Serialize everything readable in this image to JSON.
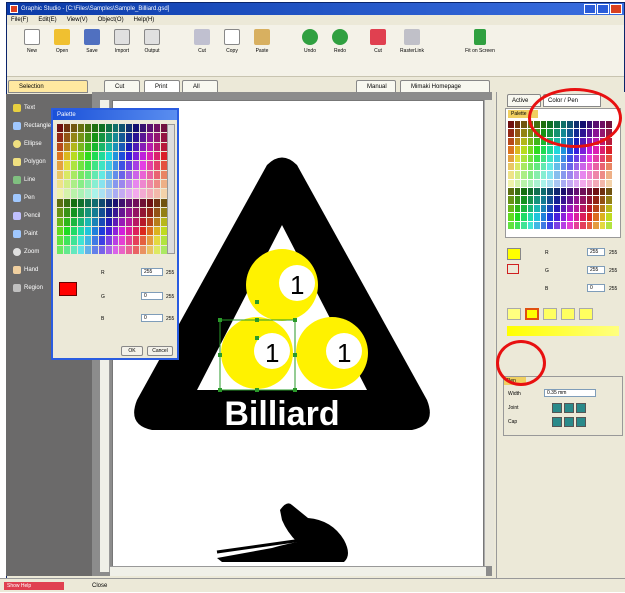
{
  "window": {
    "title": "Graphic Studio - [C:\\Files\\Samples\\Sample_Billiard.gsd]"
  },
  "menu": [
    "File(F)",
    "Edit(E)",
    "View(V)",
    "Object(O)",
    "Help(H)"
  ],
  "toolbar": [
    {
      "label": "New",
      "icon": "new-file-icon"
    },
    {
      "label": "Open",
      "icon": "folder-open-icon"
    },
    {
      "label": "Save",
      "icon": "save-icon"
    },
    {
      "label": "Import",
      "icon": "import-icon"
    },
    {
      "label": "Output",
      "icon": "output-icon"
    },
    {
      "label": "Cut",
      "icon": "scissors-icon"
    },
    {
      "label": "Copy",
      "icon": "copy-icon"
    },
    {
      "label": "Paste",
      "icon": "paste-icon"
    },
    {
      "label": "Undo",
      "icon": "undo-icon"
    },
    {
      "label": "Redo",
      "icon": "redo-icon"
    },
    {
      "label": "Cut",
      "icon": "cut-icon"
    },
    {
      "label": "RasterLink",
      "icon": "rasterlink-icon"
    },
    {
      "label": "Fit on Screen",
      "icon": "fit-screen-icon"
    }
  ],
  "tabs": {
    "selection": "Selection",
    "cut": "Cut",
    "print": "Print",
    "all": "All",
    "manual": "Manual",
    "homepage": "Mimaki Homepage"
  },
  "tools": [
    "Text",
    "Rectangle",
    "Ellipse",
    "Polygon",
    "Line",
    "Pen",
    "Pencil",
    "Paint",
    "Zoom",
    "Hand",
    "Region"
  ],
  "palette": {
    "title": "Palette",
    "values": [
      "255",
      "0",
      "0"
    ],
    "max": [
      "255",
      "255",
      "255"
    ],
    "ok": "OK",
    "cancel": "Cancel"
  },
  "canvas": {
    "text": "Billiard",
    "ball_number": "1"
  },
  "right_panel": {
    "tabs": [
      "Active",
      "Color / Pen"
    ],
    "palette_label": "Palette",
    "values": [
      "255",
      "255",
      "0"
    ],
    "max": [
      "255",
      "255",
      "255"
    ],
    "pen_title": "Pen",
    "width_label": "Width",
    "width_value": "0.35 mm",
    "joint_label": "Joint",
    "cap_label": "Cap"
  },
  "status": {
    "left": "Show Help",
    "right": "Close"
  }
}
